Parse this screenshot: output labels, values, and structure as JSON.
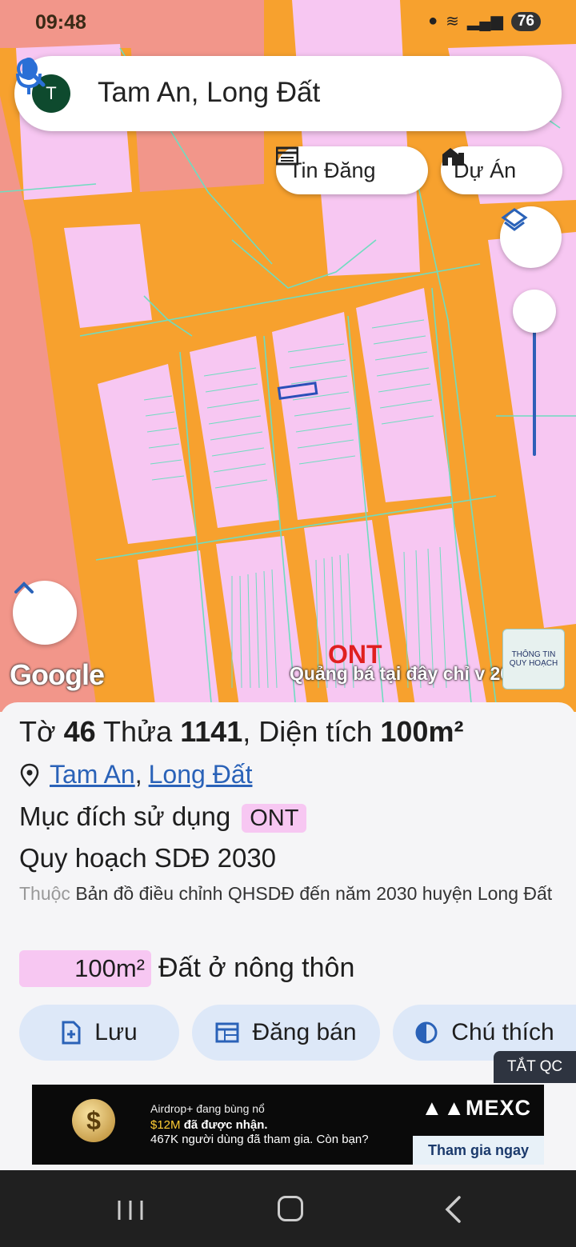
{
  "status_bar": {
    "time": "09:48",
    "battery": "76"
  },
  "search": {
    "avatar_letter": "T",
    "query": "Tam An, Long Đất"
  },
  "chips": {
    "listings": "Tin Đăng",
    "projects": "Dự Án"
  },
  "map": {
    "land_code_label": "ONT",
    "google_logo": "Google",
    "promo_text": "Quảng bá tại đây chỉ v 2030",
    "info_badge_line1": "THÔNG TIN",
    "info_badge_line2": "QUY HOẠCH",
    "zoom_level_fraction": 0.0
  },
  "parcel": {
    "title_prefix": "Tờ",
    "sheet_no": "46",
    "title_mid": "Thửa",
    "plot_no": "1141",
    "title_suffix": ", Diện tích",
    "area": "100m²",
    "commune": "Tam An",
    "district": "Long Đất",
    "separator": ",",
    "purpose_label": "Mục đích sử dụng",
    "purpose_code": "ONT",
    "plan_label": "Quy hoạch SDĐ 2030",
    "desc_prefix": "Thuộc",
    "desc_text": "Bản đồ điều chỉnh QHSDĐ đến năm 2030 huyện Long Đất",
    "legend_area": "100m²",
    "legend_label": "Đất ở nông thôn",
    "legend_color": "#f7c7f2"
  },
  "actions": {
    "save": "Lưu",
    "post_sale": "Đăng bán",
    "legend": "Chú thích"
  },
  "ad": {
    "close_label": "TẮT QC",
    "line1": "Airdrop+ đang bùng nổ",
    "line2_amount": "$12M",
    "line2_rest": "đã được nhận.",
    "line3": "467K người dùng đã tham gia. Còn bạn?",
    "brand": "MEXC",
    "cta": "Tham gia ngay"
  },
  "colors": {
    "map_orange": "#f7a12e",
    "parcel_pink": "#f7c7f2",
    "accent_blue": "#2a62b8"
  }
}
